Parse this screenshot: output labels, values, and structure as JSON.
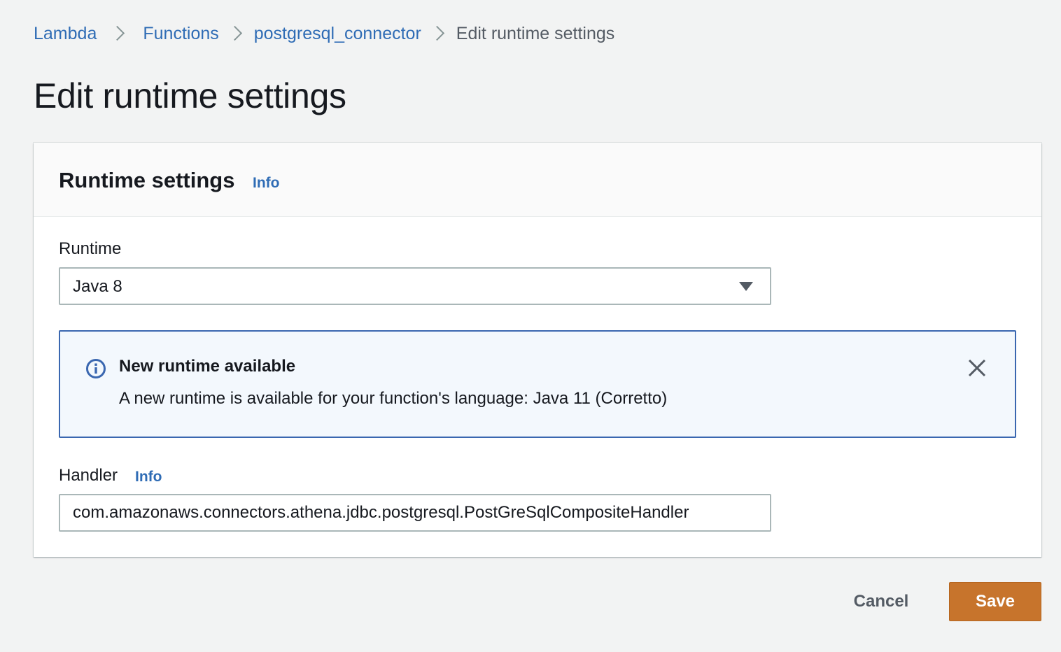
{
  "breadcrumb": {
    "items": [
      {
        "label": "Lambda"
      },
      {
        "label": "Functions"
      },
      {
        "label": "postgresql_connector"
      },
      {
        "label": "Edit runtime settings"
      }
    ]
  },
  "page": {
    "title": "Edit runtime settings"
  },
  "panel": {
    "title": "Runtime settings",
    "info_label": "Info",
    "runtime": {
      "label": "Runtime",
      "selected": "Java 8",
      "icon": "chevron-down-icon"
    },
    "alert": {
      "icon": "info-icon",
      "title": "New runtime available",
      "message": "A new runtime is available for your function's language: Java 11 (Corretto)",
      "close_icon": "close-icon"
    },
    "handler": {
      "label": "Handler",
      "info_label": "Info",
      "value": "com.amazonaws.connectors.athena.jdbc.postgresql.PostGreSqlCompositeHandler"
    }
  },
  "footer": {
    "cancel_label": "Cancel",
    "save_label": "Save"
  },
  "colors": {
    "link": "#2f6cb5",
    "primary_button": "#c7742c",
    "alert_border": "#3a67b0",
    "alert_background": "#f3f8fd",
    "page_background": "#f2f3f3"
  }
}
